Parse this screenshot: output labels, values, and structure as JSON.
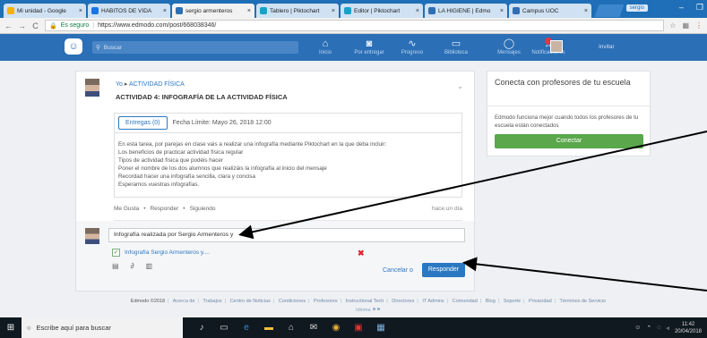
{
  "browser": {
    "tabs": [
      {
        "title": "Mi unidad - Google",
        "color": "#f4b400"
      },
      {
        "title": "HÁBITOS DE VIDA",
        "color": "#1a73e8"
      },
      {
        "title": "sergio armenteros",
        "color": "#2b6fb6",
        "active": true
      },
      {
        "title": "Tablero | Piktochart",
        "color": "#19a1c9"
      },
      {
        "title": "Editor | Piktochart",
        "color": "#19a1c9"
      },
      {
        "title": "LA HIGIENE | Edmo",
        "color": "#2b6fb6"
      },
      {
        "title": "Campus UOC",
        "color": "#2f6db5"
      }
    ],
    "profile": "sergio",
    "secure_label": "Es seguro",
    "url": "https://www.edmodo.com/post/668038346/"
  },
  "appnav": {
    "search_placeholder": "Buscar",
    "items": [
      "Inicio",
      "Por entregar",
      "Progreso",
      "Biblioteca",
      "Mensajes",
      "Notificaciones"
    ],
    "invite": "Invitar"
  },
  "post": {
    "to_prefix": "Yo",
    "to_arrow": "▸",
    "to_group": "ACTIVIDAD FÍSICA",
    "title": "ACTIVIDAD 4: INFOGRAFÍA DE LA ACTIVIDAD FÍSICA",
    "entregas": "Entregas (0)",
    "deadline": "Fecha Límite: Mayo 26, 2018 12:00",
    "body": [
      "En esta tarea, por parejas en clase vais a realizar una infografía mediante Piktochart en la que deba incluir:",
      "Los beneficios de practicar actividad física regular",
      "Tipos de actividad física que podéis hacer",
      "Poner el nombre de los dos alumnos que realizáis la infografía al inicio del mensaje",
      "Recordad hacer una infografía sencilla, clara y concisa",
      "Esperamos vuestras infografías."
    ],
    "like": "Me Gusta",
    "respond": "Responder",
    "follow": "Siguiendo",
    "when": "hace un día"
  },
  "reply": {
    "text": "Infografía realizada por Sergio Armenteros y",
    "attachment": "Infografía Sergio Armenteros y....",
    "cancel": "Cancelar o",
    "submit": "Responder"
  },
  "side": {
    "title": "Conecta con profesores de tu escuela",
    "text": "Edmodo funciona mejor cuando todos los profesores de tu escuela están conectados",
    "button": "Conectar"
  },
  "footer": {
    "links": [
      "Edmodo ©2018",
      "Acerca de",
      "Trabajos",
      "Centro de Noticias",
      "Condiciones",
      "Profesores",
      "Instructional Tech",
      "Directores",
      "IT Admins",
      "Comunidad",
      "Blog",
      "Soporte",
      "Privacidad",
      "Términos de Servicio"
    ],
    "language": "Idioma"
  },
  "taskbar": {
    "search": "Escribe aquí para buscar",
    "time": "11:42",
    "date": "20/04/2018"
  }
}
